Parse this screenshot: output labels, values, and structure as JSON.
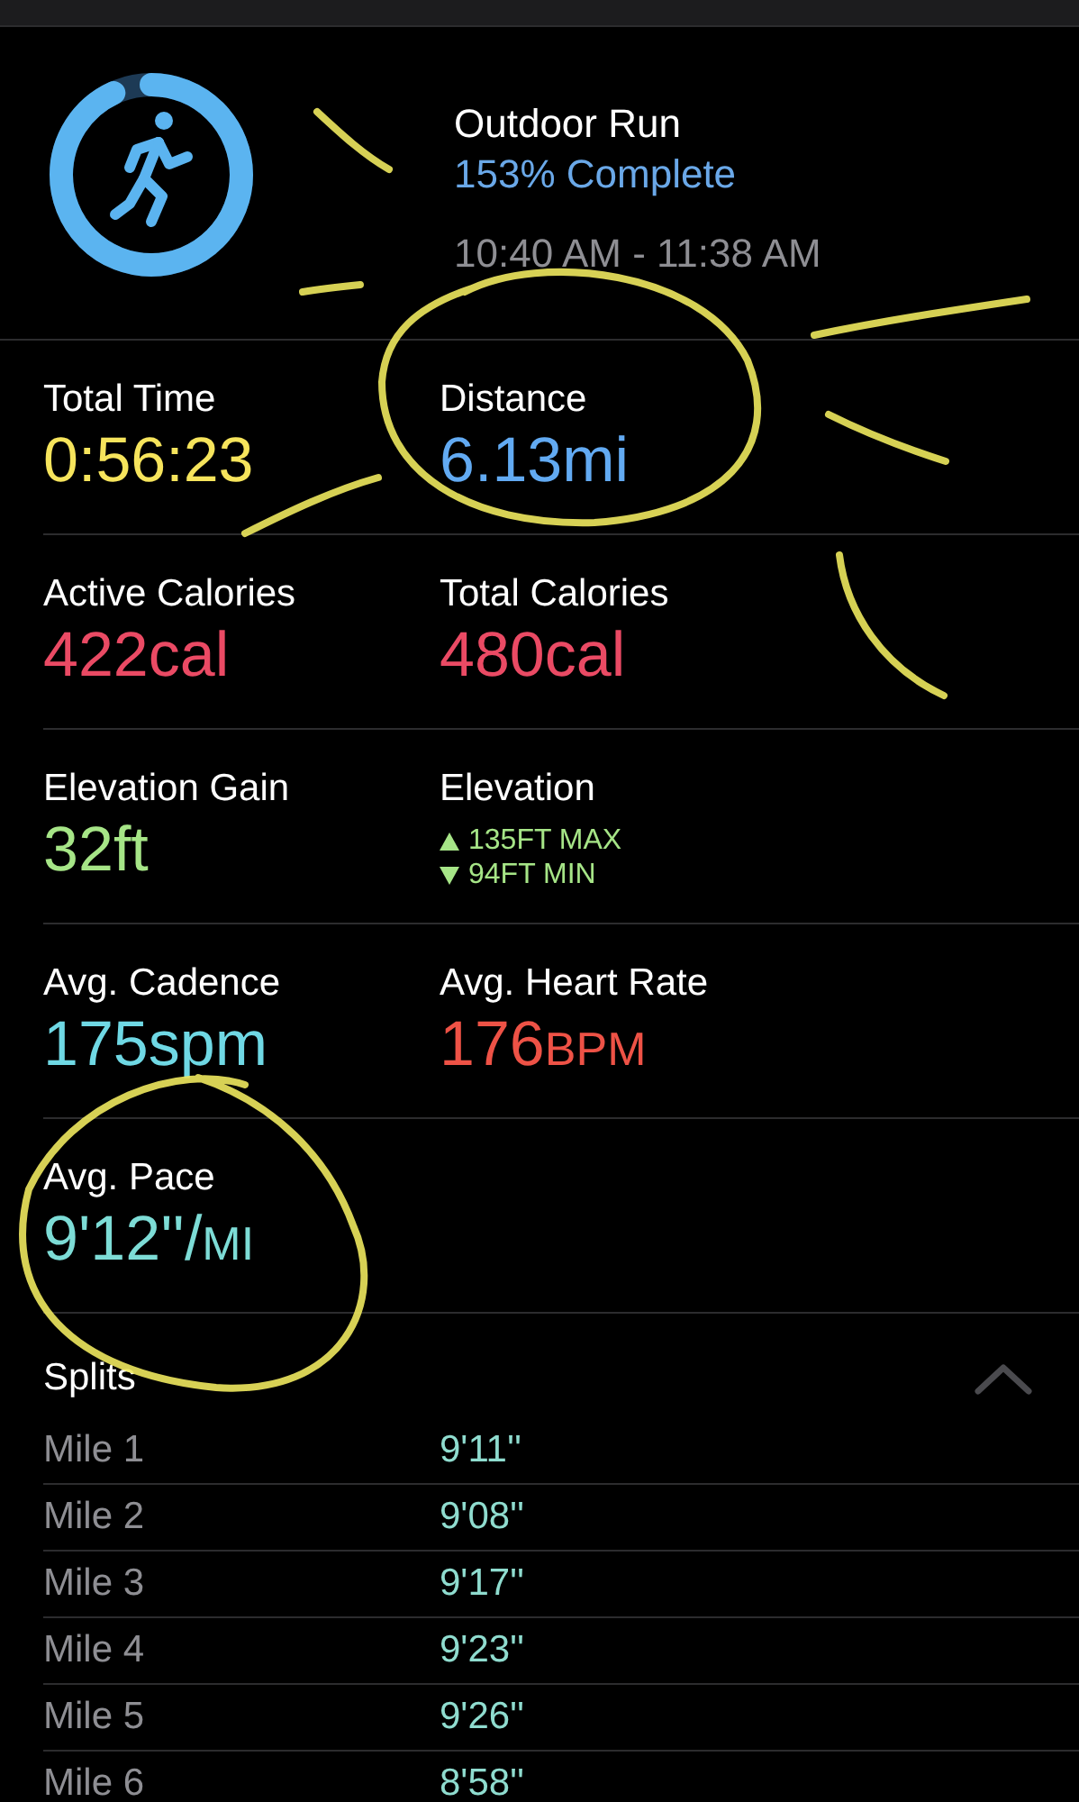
{
  "workout": {
    "title": "Outdoor Run",
    "progress": "153% Complete",
    "time_range": "10:40 AM - 11:38 AM"
  },
  "metric_rows": [
    [
      {
        "kind": "value",
        "label": "Total Time",
        "value": "0:56:23",
        "color": "#f6e45c"
      },
      {
        "kind": "value",
        "label": "Distance",
        "value": "6.13",
        "unit": "mi",
        "color": "#62aaf2"
      }
    ],
    [
      {
        "kind": "value",
        "label": "Active Calories",
        "value": "422",
        "unit": "cal",
        "color": "#ea4a64"
      },
      {
        "kind": "value",
        "label": "Total Calories",
        "value": "480",
        "unit": "cal",
        "color": "#ea4a64"
      }
    ],
    [
      {
        "kind": "value",
        "label": "Elevation Gain",
        "value": "32",
        "unit": "ft",
        "color": "#a6e587"
      },
      {
        "kind": "range",
        "label": "Elevation",
        "color": "#a6e587",
        "lines": [
          {
            "kind": "up",
            "text": "135FT MAX"
          },
          {
            "kind": "down",
            "text": "94FT MIN"
          }
        ]
      }
    ],
    [
      {
        "kind": "value",
        "label": "Avg. Cadence",
        "value": "175",
        "unit": "spm",
        "color": "#6fd8e4"
      },
      {
        "kind": "value",
        "label": "Avg. Heart Rate",
        "value": "176",
        "unit": "BPM",
        "small_unit": true,
        "color": "#ee5246"
      }
    ],
    [
      {
        "kind": "value",
        "label": "Avg. Pace",
        "value": "9'12''/",
        "unit": "MI",
        "small_unit": true,
        "color": "#7ddcd6"
      }
    ]
  ],
  "splits": {
    "title": "Splits",
    "expanded": true,
    "rows": [
      {
        "label": "Mile 1",
        "pace": "9'11''"
      },
      {
        "label": "Mile 2",
        "pace": "9'08''"
      },
      {
        "label": "Mile 3",
        "pace": "9'17''"
      },
      {
        "label": "Mile 4",
        "pace": "9'23''"
      },
      {
        "label": "Mile 5",
        "pace": "9'26''"
      },
      {
        "label": "Mile 6",
        "pace": "8'58''"
      }
    ]
  }
}
